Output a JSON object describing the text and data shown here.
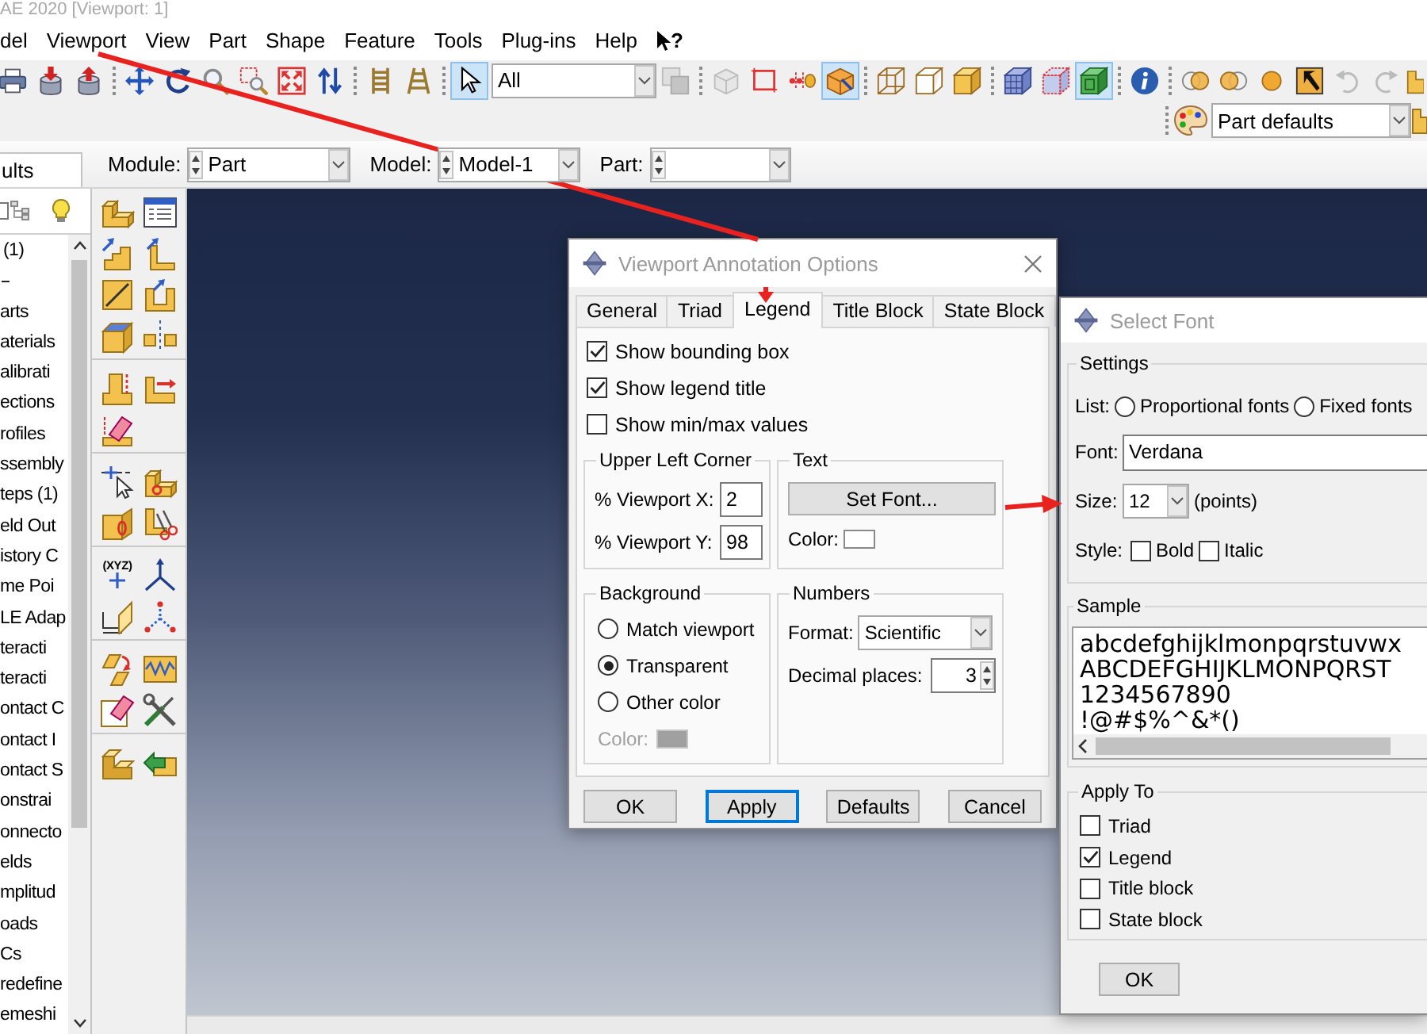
{
  "window": {
    "title": "AE 2020 [Viewport: 1]"
  },
  "menu_bar": {
    "items": [
      "del",
      "Viewport",
      "View",
      "Part",
      "Shape",
      "Feature",
      "Tools",
      "Plug-ins",
      "Help"
    ],
    "whats_this": "?"
  },
  "toolbar": {
    "file_buttons": [
      {
        "selected": false
      },
      {
        "selected": false
      },
      {
        "selected": false
      }
    ],
    "view_buttons": [
      {
        "selected": false
      },
      {
        "selected": false
      },
      {
        "selected": false
      },
      {
        "selected": false
      },
      {
        "selected": false
      },
      {
        "selected": false
      }
    ],
    "ladder_buttons": [
      {
        "selected": false
      },
      {
        "selected": false
      }
    ],
    "pointer_button": {
      "selected": true
    },
    "selection_filter": "All",
    "filter_button": {
      "selected": false,
      "disabled": true
    },
    "selection_buttons": [
      {
        "selected": false,
        "disabled": true
      },
      {
        "selected": false,
        "disabled": false
      },
      {
        "selected": false,
        "disabled": false
      },
      {
        "selected": true,
        "disabled": false
      }
    ],
    "render_buttons": [
      {
        "selected": false
      },
      {
        "selected": false
      },
      {
        "selected": false
      }
    ],
    "mesh_buttons": [
      {
        "selected": false
      },
      {
        "selected": false
      },
      {
        "selected": true
      }
    ],
    "info_button": {
      "selected": false
    },
    "display_buttons": [
      {
        "selected": false,
        "disabled": false
      },
      {
        "selected": false,
        "disabled": false
      },
      {
        "selected": false,
        "disabled": false
      },
      {
        "selected": false,
        "disabled": false
      },
      {
        "selected": false,
        "disabled": true
      },
      {
        "selected": false,
        "disabled": true
      },
      {
        "selected": false,
        "disabled": false
      }
    ],
    "color_code": "Part defaults"
  },
  "context_bar": {
    "panel_tab": "ults",
    "module": {
      "label": "Module:",
      "value": "Part"
    },
    "model": {
      "label": "Model:",
      "value": "Model-1"
    },
    "part": {
      "label": "Part:"
    }
  },
  "model_tree": {
    "items": [
      {
        "label": "(1)",
        "children": [
          {
            "label": "arts"
          },
          {
            "label": "aterials"
          },
          {
            "label": "alibrati"
          },
          {
            "label": "ections"
          },
          {
            "label": "rofiles"
          },
          {
            "label": "ssembly"
          },
          {
            "label": "teps (1)"
          },
          {
            "label": "eld Out"
          },
          {
            "label": "istory C"
          },
          {
            "label": "me Poi"
          },
          {
            "label": "LE Adap"
          },
          {
            "label": "teracti"
          },
          {
            "label": "teracti"
          },
          {
            "label": "ontact C"
          },
          {
            "label": "ontact I"
          },
          {
            "label": "ontact S"
          },
          {
            "label": "onstrai"
          },
          {
            "label": "onnecto"
          },
          {
            "label": "elds"
          },
          {
            "label": "mplitud"
          },
          {
            "label": "oads"
          },
          {
            "label": "Cs"
          },
          {
            "label": "redefine"
          },
          {
            "label": "emeshi"
          }
        ]
      }
    ]
  },
  "toolbox": {
    "datum_point_caption": "(XYZ)"
  },
  "annotation_dialog": {
    "title": "Viewport Annotation Options",
    "tabs": [
      {
        "label": "General",
        "selected": false
      },
      {
        "label": "Triad",
        "selected": false
      },
      {
        "label": "Legend",
        "selected": true
      },
      {
        "label": "Title Block",
        "selected": false
      },
      {
        "label": "State Block",
        "selected": false
      }
    ],
    "options": [
      {
        "label": "Show bounding box",
        "checked": true
      },
      {
        "label": "Show legend title",
        "checked": true
      },
      {
        "label": "Show min/max values",
        "checked": false
      }
    ],
    "upper_left_corner": {
      "title": "Upper Left Corner",
      "fields": [
        {
          "label": "% Viewport X:",
          "value": "2"
        },
        {
          "label": "% Viewport Y:",
          "value": "98"
        }
      ]
    },
    "text": {
      "title": "Text",
      "set_font_button": "Set Font...",
      "color_label": "Color:",
      "color": "#ffffff"
    },
    "background": {
      "title": "Background",
      "options": [
        {
          "label": "Match viewport",
          "selected": false
        },
        {
          "label": "Transparent",
          "selected": true
        },
        {
          "label": "Other color",
          "selected": false
        }
      ],
      "color_label": "Color:",
      "color_disabled": true,
      "color": "#a0a0a0"
    },
    "numbers": {
      "title": "Numbers",
      "format_label": "Format:",
      "format": "Scientific",
      "decimal_label": "Decimal places:",
      "decimal_places": "3"
    },
    "buttons": [
      {
        "label": "OK",
        "focused": false
      },
      {
        "label": "Apply",
        "focused": true
      },
      {
        "label": "Defaults",
        "focused": false
      },
      {
        "label": "Cancel",
        "focused": false
      }
    ]
  },
  "font_dialog": {
    "title": "Select Font",
    "settings": {
      "title": "Settings",
      "list_label": "List:",
      "list_options": [
        {
          "label": "Proportional fonts",
          "selected": false
        },
        {
          "label": "Fixed fonts",
          "selected": false
        }
      ],
      "font_label": "Font:",
      "font": "Verdana",
      "size_label": "Size:",
      "size": "12",
      "size_unit": "(points)",
      "style_label": "Style:",
      "styles": [
        {
          "label": "Bold",
          "checked": false
        },
        {
          "label": "Italic",
          "checked": false
        }
      ]
    },
    "sample": {
      "title": "Sample",
      "lines": [
        "abcdefghijklmonpqrstuvwx",
        "ABCDEFGHIJKLMONPQRST",
        "1234567890",
        "!@#$%^&*()"
      ]
    },
    "apply_to": {
      "title": "Apply To",
      "items": [
        {
          "label": "Triad",
          "checked": false
        },
        {
          "label": "Legend",
          "checked": true
        },
        {
          "label": "Title block",
          "checked": false
        },
        {
          "label": "State block",
          "checked": false
        }
      ]
    },
    "buttons": [
      "OK"
    ]
  }
}
